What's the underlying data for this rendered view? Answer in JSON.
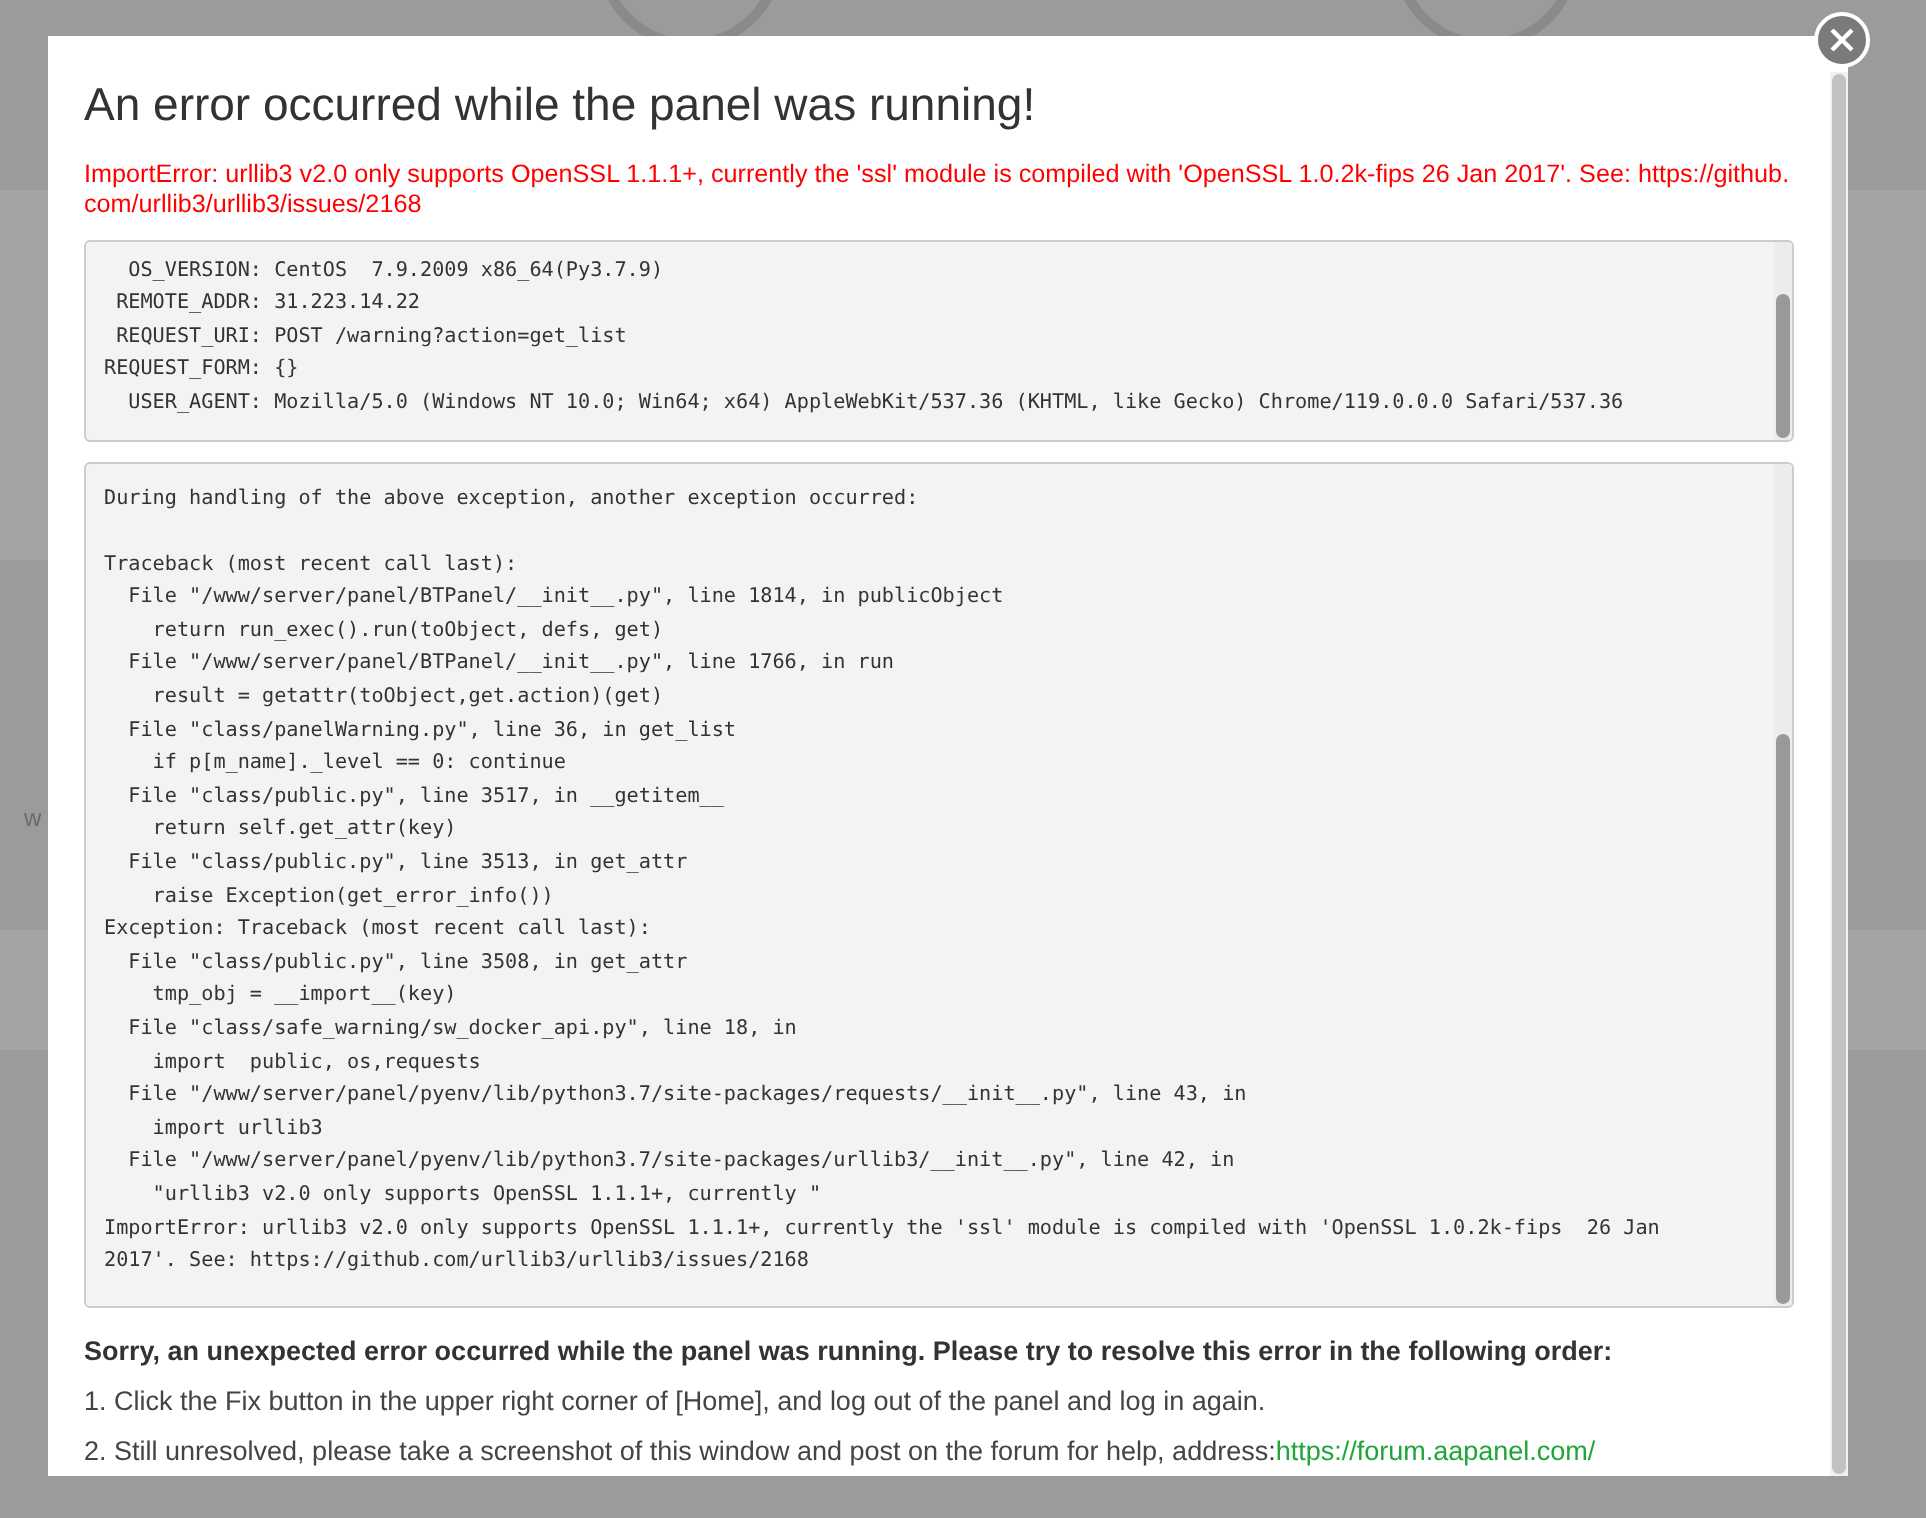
{
  "background": {
    "side_text": "w"
  },
  "dialog": {
    "title": "An error occurred while the panel was running!",
    "error_summary": "ImportError: urllib3 v2.0 only supports OpenSSL 1.1.1+, currently the 'ssl' module is compiled with 'OpenSSL 1.0.2k-fips 26 Jan 2017'. See: https://github.com/urllib3/urllib3/issues/2168",
    "request_info": [
      "  OS_VERSION: CentOS  7.9.2009 x86_64(Py3.7.9)",
      " REMOTE_ADDR: 31.223.14.22",
      " REQUEST_URI: POST /warning?action=get_list",
      "REQUEST_FORM: {}",
      "  USER_AGENT: Mozilla/5.0 (Windows NT 10.0; Win64; x64) AppleWebKit/537.36 (KHTML, like Gecko) Chrome/119.0.0.0 Safari/537.36"
    ],
    "traceback_intro": "During handling of the above exception, another exception occurred:",
    "traceback": [
      "Traceback (most recent call last):",
      "  File \"/www/server/panel/BTPanel/__init__.py\", line 1814, in publicObject",
      "    return run_exec().run(toObject, defs, get)",
      "  File \"/www/server/panel/BTPanel/__init__.py\", line 1766, in run",
      "    result = getattr(toObject,get.action)(get)",
      "  File \"class/panelWarning.py\", line 36, in get_list",
      "    if p[m_name]._level == 0: continue",
      "  File \"class/public.py\", line 3517, in __getitem__",
      "    return self.get_attr(key)",
      "  File \"class/public.py\", line 3513, in get_attr",
      "    raise Exception(get_error_info())",
      "Exception: Traceback (most recent call last):",
      "  File \"class/public.py\", line 3508, in get_attr",
      "    tmp_obj = __import__(key)",
      "  File \"class/safe_warning/sw_docker_api.py\", line 18, in",
      "    import  public, os,requests",
      "  File \"/www/server/panel/pyenv/lib/python3.7/site-packages/requests/__init__.py\", line 43, in",
      "    import urllib3",
      "  File \"/www/server/panel/pyenv/lib/python3.7/site-packages/urllib3/__init__.py\", line 42, in",
      "    \"urllib3 v2.0 only supports OpenSSL 1.1.1+, currently \"",
      "ImportError: urllib3 v2.0 only supports OpenSSL 1.1.1+, currently the 'ssl' module is compiled with 'OpenSSL 1.0.2k-fips  26 Jan",
      "2017'. See: https://github.com/urllib3/urllib3/issues/2168"
    ],
    "help_heading": "Sorry, an unexpected error occurred while the panel was running. Please try to resolve this error in the following order:",
    "steps": [
      {
        "text": "1. Click the Fix button in the upper right corner of [Home], and log out of the panel and log in again."
      },
      {
        "text": "2. Still unresolved, please take a screenshot of this window and post on the forum for help, address:",
        "link": "https://forum.aapanel.com/"
      }
    ]
  }
}
